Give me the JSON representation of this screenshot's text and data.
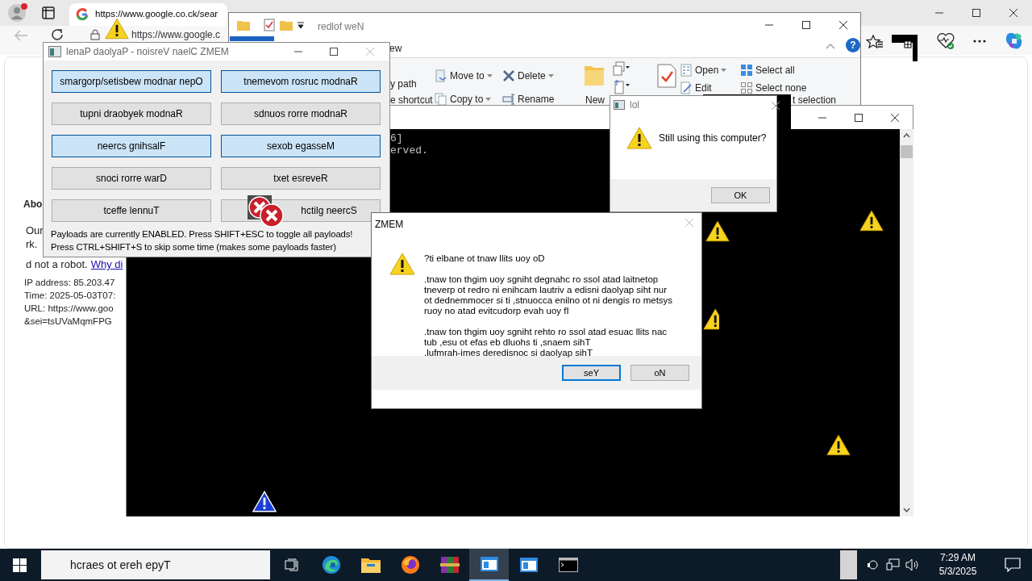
{
  "browser": {
    "tab_title": "https://www.google.co.ck/sear",
    "address": "https://www.google.c",
    "page": {
      "heading": "Abo",
      "lines": [
        "Our",
        "rk."
      ],
      "robot_line": "d not a robot.",
      "robot_link": "Why di",
      "details": [
        "IP address: 85.203.47",
        "Time: 2025-05-03T07:",
        "URL: https://www.goo",
        "&sei=tsUVaMqmFPG"
      ]
    }
  },
  "explorer": {
    "title": "redlof weN",
    "ribbon_tab": "ew",
    "help": "?",
    "commands": [
      {
        "label": "y path",
        "kind": "plain"
      },
      {
        "label": "e shortcut",
        "kind": "plain"
      },
      {
        "label": "Move to",
        "kind": "menu"
      },
      {
        "label": "Copy to",
        "kind": "menu"
      },
      {
        "label": "Delete",
        "kind": "menu"
      },
      {
        "label": "Rename",
        "kind": "plain"
      },
      {
        "label": "New",
        "kind": "big"
      },
      {
        "label": "Open",
        "kind": "menu"
      },
      {
        "label": "Edit",
        "kind": "plain"
      },
      {
        "label": "Select all",
        "kind": "plain"
      },
      {
        "label": "Select none",
        "kind": "plain"
      },
      {
        "label": "t selection",
        "kind": "plain"
      }
    ]
  },
  "console": {
    "lines": [
      "6]",
      "erved."
    ]
  },
  "memz_panel": {
    "title": "lenaP daolyaP - noisreV naelC ZMEM",
    "payloads": [
      {
        "label": "smargorp/setisbew modnar nepO",
        "on": true
      },
      {
        "label": "tnemevom rosruc modnaR",
        "on": true
      },
      {
        "label": "tupni draobyek modnaR",
        "on": false
      },
      {
        "label": "sdnuos rorre modnaR",
        "on": false
      },
      {
        "label": "neercs gnihsalF",
        "on": true
      },
      {
        "label": "sexob egasseM",
        "on": true
      },
      {
        "label": "snoci rorre warD",
        "on": false
      },
      {
        "label": "txet esreveR",
        "on": false
      },
      {
        "label": "tceffe lennuT",
        "on": false
      },
      {
        "label": "hctilg neercS",
        "on": false
      }
    ],
    "notes": [
      "Payloads are currently ENABLED. Press SHIFT+ESC to toggle all payloads!",
      "Press CTRL+SHIFT+S to skip some time (makes some payloads faster)"
    ]
  },
  "lol_dialog": {
    "title": "lol",
    "message": "Still using this computer?",
    "button": "OK"
  },
  "memz_dialog": {
    "title": "ZMEM",
    "paragraphs": [
      [
        "?ti elbane ot tnaw llits uoy oD"
      ],
      [
        ".tnaw ton thgim uoy sgniht degnahc ro ssol atad laitnetop",
        "tneverp ot redro ni enihcam lautriv a edisni daolyap siht nur",
        "ot dednemmocer si ti ,stnuocca enilno ot ni dengis ro metsys",
        "ruoy no atad evitcudorp evah uoy fI"
      ],
      [
        ".tnaw ton thgim uoy sgniht rehto ro ssol atad esuac llits nac",
        "tub ,esu ot efas eb dluohs ti ,snaem sihT",
        ".lufmrah-imes deredisnoc si daolyap sihT"
      ]
    ],
    "buttons": [
      {
        "label": "seY",
        "selected": true
      },
      {
        "label": "oN",
        "selected": false
      }
    ]
  },
  "taskbar": {
    "search": {
      "placeholder": "hcraes ot ereh epyT"
    },
    "apps": [
      {
        "kind": "taskview",
        "selected": false
      },
      {
        "kind": "edge",
        "selected": false
      },
      {
        "kind": "folder",
        "selected": false
      },
      {
        "kind": "firefox",
        "selected": false
      },
      {
        "kind": "archiver",
        "selected": false
      },
      {
        "kind": "window",
        "selected": true
      },
      {
        "kind": "window",
        "selected": false
      },
      {
        "kind": "console",
        "selected": false
      }
    ],
    "time": "7:29 AM",
    "date": "5/3/2025"
  }
}
